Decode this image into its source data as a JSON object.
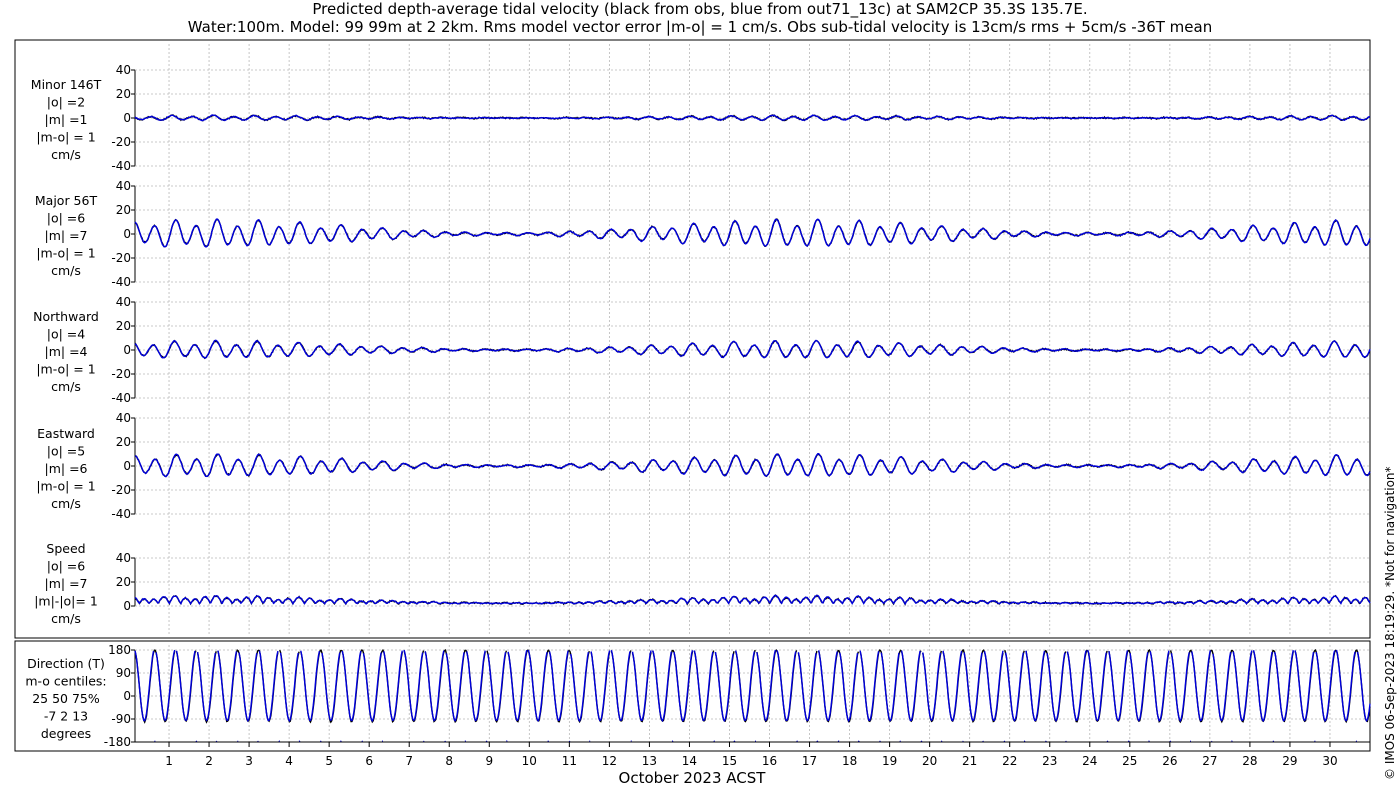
{
  "title_line1": "Predicted depth-average tidal velocity (black from obs, blue from out71_13c) at SAM2CP 35.3S 135.7E.",
  "title_line2": "Water:100m. Model: 99 99m at 2 2km. Rms model vector error |m-o| = 1 cm/s. Obs sub-tidal velocity is 13cm/s rms + 5cm/s -36T mean",
  "copyright": "© IMOS 06-Sep-2023 18:19:29. *Not for navigation*",
  "colors": {
    "obs": "#000000",
    "model": "#0000dd",
    "grid": "#b8b8b8",
    "axis": "#000000"
  },
  "chart_data": [
    {
      "type": "line",
      "id": "minor",
      "label_lines": [
        "Minor 146T",
        "|o| =2",
        "|m| =1",
        "|m-o| = 1",
        "cm/s"
      ],
      "ylim": [
        -40,
        40
      ],
      "yticks": [
        -40,
        -20,
        0,
        20,
        40
      ],
      "amplitude": 2,
      "series": [
        {
          "name": "obs",
          "color": "#000000"
        },
        {
          "name": "model",
          "color": "#0000dd"
        }
      ]
    },
    {
      "type": "line",
      "id": "major",
      "label_lines": [
        "Major 56T",
        "|o| =6",
        "|m| =7",
        "|m-o| = 1",
        "cm/s"
      ],
      "ylim": [
        -40,
        40
      ],
      "yticks": [
        -40,
        -20,
        0,
        20,
        40
      ],
      "amplitude": 11,
      "series": [
        {
          "name": "obs",
          "color": "#000000"
        },
        {
          "name": "model",
          "color": "#0000dd"
        }
      ]
    },
    {
      "type": "line",
      "id": "north",
      "label_lines": [
        "Northward",
        "|o| =4",
        "|m| =4",
        "|m-o| = 1",
        "cm/s"
      ],
      "ylim": [
        -40,
        40
      ],
      "yticks": [
        -40,
        -20,
        0,
        20,
        40
      ],
      "amplitude": 7,
      "series": [
        {
          "name": "obs",
          "color": "#000000"
        },
        {
          "name": "model",
          "color": "#0000dd"
        }
      ]
    },
    {
      "type": "line",
      "id": "east",
      "label_lines": [
        "Eastward",
        "|o| =5",
        "|m| =6",
        "|m-o| = 1",
        "cm/s"
      ],
      "ylim": [
        -40,
        40
      ],
      "yticks": [
        -40,
        -20,
        0,
        20,
        40
      ],
      "amplitude": 9,
      "series": [
        {
          "name": "obs",
          "color": "#000000"
        },
        {
          "name": "model",
          "color": "#0000dd"
        }
      ]
    },
    {
      "type": "line",
      "id": "speed",
      "label_lines": [
        "Speed",
        "|o| =6",
        "|m| =7",
        "|m|-|o|= 1",
        "cm/s"
      ],
      "ylim": [
        0,
        40
      ],
      "yticks": [
        0,
        20,
        40
      ],
      "amplitude": 11,
      "series": [
        {
          "name": "obs",
          "color": "#000000"
        },
        {
          "name": "model",
          "color": "#0000dd"
        }
      ]
    },
    {
      "type": "line",
      "id": "direction",
      "label_lines": [
        "Direction (T)",
        "m-o centiles:",
        "25  50  75%",
        "-7   2  13",
        "degrees"
      ],
      "ylim": [
        -180,
        180
      ],
      "yticks": [
        -180,
        -90,
        0,
        90,
        180
      ],
      "series": [
        {
          "name": "obs",
          "color": "#000000"
        },
        {
          "name": "model",
          "color": "#0000dd"
        }
      ]
    }
  ],
  "x_axis": {
    "label": "October 2023 ACST",
    "xlim": [
      0.15,
      31.0
    ],
    "ticks": [
      1,
      2,
      3,
      4,
      5,
      6,
      7,
      8,
      9,
      10,
      11,
      12,
      13,
      14,
      15,
      16,
      17,
      18,
      19,
      20,
      21,
      22,
      23,
      24,
      25,
      26,
      27,
      28,
      29,
      30
    ],
    "tick_labels": [
      "1",
      "2",
      "3",
      "4",
      "5",
      "6",
      "7",
      "8",
      "9",
      "10",
      "11",
      "12",
      "13",
      "14",
      "15",
      "16",
      "17",
      "18",
      "19",
      "20",
      "21",
      "22",
      "23",
      "24",
      "25",
      "26",
      "27",
      "28",
      "29",
      "30"
    ]
  }
}
